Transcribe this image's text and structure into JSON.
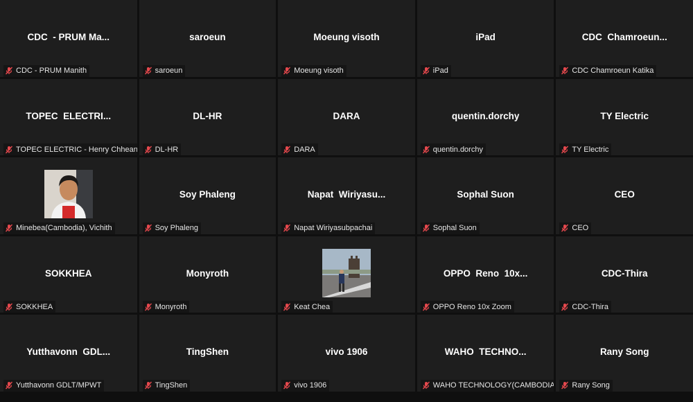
{
  "colors": {
    "tile_background": "#1e1e1e",
    "muted_mic": "#e5484d",
    "label_text": "#e6e6e6",
    "name_text": "#ffffff"
  },
  "participants": [
    {
      "display": "CDC  - PRUM Ma...",
      "label": "CDC - PRUM Manith",
      "photo": false
    },
    {
      "display": "saroeun",
      "label": "saroeun",
      "photo": false
    },
    {
      "display": "Moeung visoth",
      "label": "Moeung visoth",
      "photo": false
    },
    {
      "display": "iPad",
      "label": "iPad",
      "photo": false
    },
    {
      "display": "CDC  Chamroeun...",
      "label": "CDC Chamroeun Katika",
      "photo": false
    },
    {
      "display": "TOPEC  ELECTRI...",
      "label": "TOPEC ELECTRIC - Henry Chheang",
      "photo": false
    },
    {
      "display": "DL-HR",
      "label": "DL-HR",
      "photo": false
    },
    {
      "display": "DARA",
      "label": "DARA",
      "photo": false
    },
    {
      "display": "quentin.dorchy",
      "label": "quentin.dorchy",
      "photo": false
    },
    {
      "display": "TY Electric",
      "label": "TY Electric",
      "photo": false
    },
    {
      "display": "",
      "label": "Minebea(Cambodia), Vichith",
      "photo": true,
      "photo_kind": "portrait-photo"
    },
    {
      "display": "Soy Phaleng",
      "label": "Soy Phaleng",
      "photo": false
    },
    {
      "display": "Napat  Wiriyasu...",
      "label": "Napat Wiriyasubpachai",
      "photo": false
    },
    {
      "display": "Sophal Suon",
      "label": "Sophal Suon",
      "photo": false
    },
    {
      "display": "CEO",
      "label": "CEO",
      "photo": false
    },
    {
      "display": "SOKKHEA",
      "label": "SOKKHEA",
      "photo": false
    },
    {
      "display": "Monyroth",
      "label": "Monyroth",
      "photo": false
    },
    {
      "display": "",
      "label": "Keat Chea",
      "photo": true,
      "photo_kind": "outdoor-photo"
    },
    {
      "display": "OPPO  Reno  10x...",
      "label": "OPPO Reno 10x Zoom",
      "photo": false
    },
    {
      "display": "CDC-Thira",
      "label": "CDC-Thira",
      "photo": false
    },
    {
      "display": "Yutthavonn  GDL...",
      "label": "Yutthavonn GDLT/MPWT",
      "photo": false
    },
    {
      "display": "TingShen",
      "label": "TingShen",
      "photo": false
    },
    {
      "display": "vivo 1906",
      "label": "vivo 1906",
      "photo": false
    },
    {
      "display": "WAHO  TECHNO...",
      "label": "WAHO TECHNOLOGY(CAMBODIA)",
      "photo": false
    },
    {
      "display": "Rany Song",
      "label": "Rany Song",
      "photo": false
    }
  ]
}
